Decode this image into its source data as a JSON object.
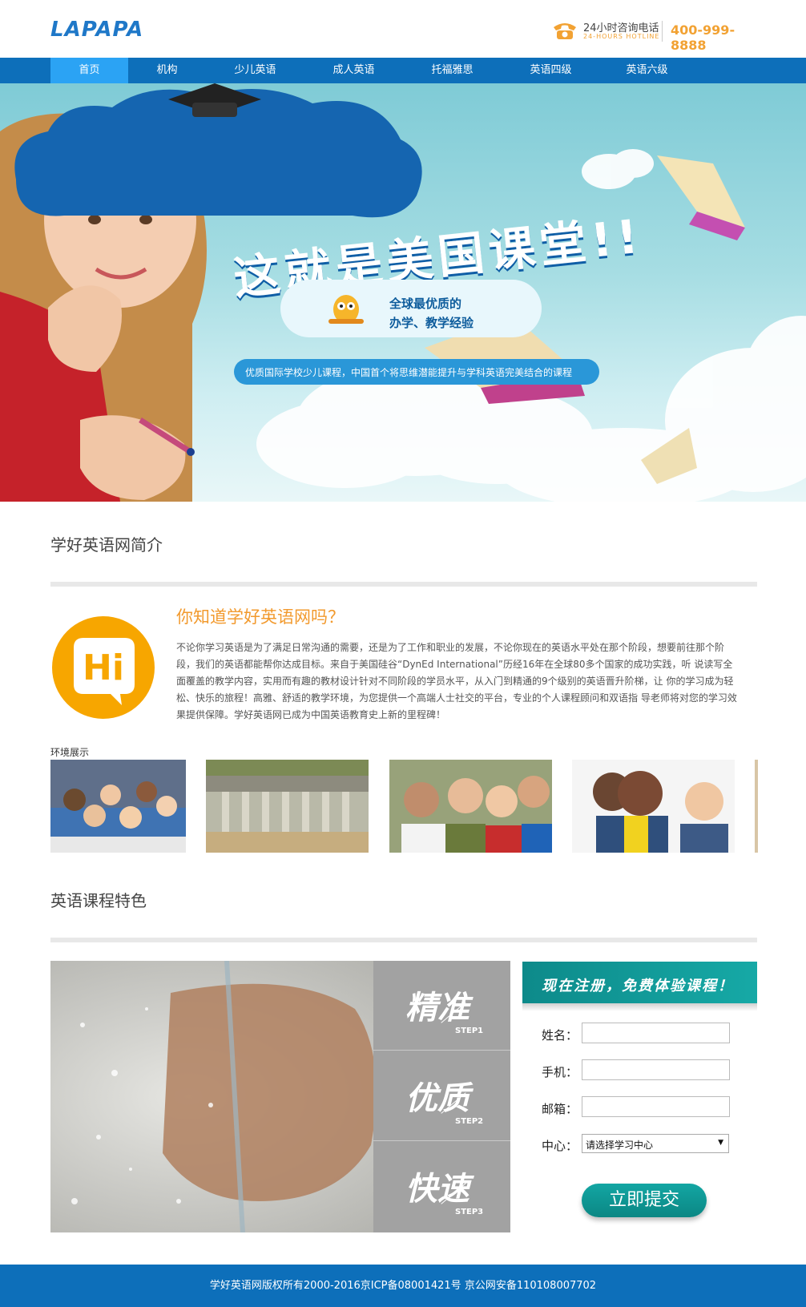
{
  "header": {
    "logo": "LAPAPA",
    "hotline_cn": "24小时咨询电话",
    "hotline_en": "24-HOURS HOTLINE",
    "hotline_number": "400-999-8888"
  },
  "nav": {
    "items": [
      {
        "label": "首页",
        "active": true
      },
      {
        "label": "机构"
      },
      {
        "label": "少儿英语"
      },
      {
        "label": "成人英语"
      },
      {
        "label": "托福雅思"
      },
      {
        "label": "英语四级"
      },
      {
        "label": "英语六级"
      }
    ]
  },
  "banner": {
    "title": "这就是美国课堂!!",
    "sub1": "全球最优质的",
    "sub2": "办学、教学经验",
    "desc": "优质国际学校少儿课程，中国首个将思维潜能提升与学科英语完美结合的课程",
    "active_slide": 1,
    "slide_count": 3
  },
  "intro": {
    "section_title": "学好英语网简介",
    "hi_text": "Hi",
    "heading": "你知道学好英语网吗？",
    "paragraph": "不论你学习英语是为了满足日常沟通的需要，还是为了工作和职业的发展，不论你现在的英语水平处在那个阶段，想要前往那个阶段，我们的英语都能帮你达成目标。来自于美国硅谷“DynEd International”历经16年在全球80多个国家的成功实践，听 说读写全面覆盖的教学内容，实用而有趣的教材设计针对不同阶段的学员水平，从入门到精通的9个级别的英语晋升阶梯，让 你的学习成为轻松、快乐的旅程！高雅、舒适的教学环境，为您提供一个高端人士社交的平台，专业的个人课程顾问和双语指 导老师将对您的学习效果提供保障。学好英语网已成为中国英语教育史上新的里程碑！"
  },
  "environment": {
    "label": "环境展示"
  },
  "features": {
    "section_title": "英语课程特色",
    "steps": [
      {
        "title": "精准",
        "tag": "STEP1"
      },
      {
        "title": "优质",
        "tag": "STEP2"
      },
      {
        "title": "快速",
        "tag": "STEP3"
      }
    ]
  },
  "form": {
    "banner_text": "现在注册，免费体验课程！",
    "name_label": "姓名：",
    "phone_label": "手机：",
    "email_label": "邮箱：",
    "center_label": "中心：",
    "center_selected": "请选择学习中心",
    "submit_label": "立即提交"
  },
  "footer": {
    "text": "学好英语网版权所有2000-2016京ICP备08001421号 京公网安备110108007702"
  },
  "colors": {
    "nav_blue": "#0d6fba",
    "nav_active": "#2ba3f4",
    "accent_orange": "#f29a2e",
    "teal": "#13a6a3"
  }
}
